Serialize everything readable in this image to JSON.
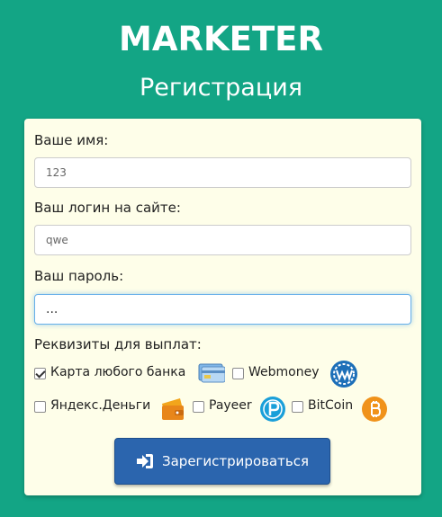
{
  "header": {
    "brand": "MARKETER",
    "subtitle": "Регистрация"
  },
  "form": {
    "name_label": "Ваше имя:",
    "name_value": "123",
    "login_label": "Ваш логин на сайте:",
    "login_value": "qwe",
    "password_label": "Ваш пароль:",
    "password_value": "...",
    "payout_label": "Реквизиты для выплат:",
    "payout_options": [
      {
        "label": "Карта любого банка",
        "checked": true,
        "icon": "bank-card-icon"
      },
      {
        "label": "Webmoney",
        "checked": false,
        "icon": "webmoney-icon"
      },
      {
        "label": "Яндекс.Деньги",
        "checked": false,
        "icon": "yandex-money-icon"
      },
      {
        "label": "Payeer",
        "checked": false,
        "icon": "payeer-icon"
      },
      {
        "label": "BitCoin",
        "checked": false,
        "icon": "bitcoin-icon"
      }
    ],
    "submit_label": "Зарегистрироваться",
    "submit_icon": "sign-in-icon"
  },
  "colors": {
    "background": "#13a585",
    "card": "#fefee9",
    "button": "#2b65ae"
  }
}
